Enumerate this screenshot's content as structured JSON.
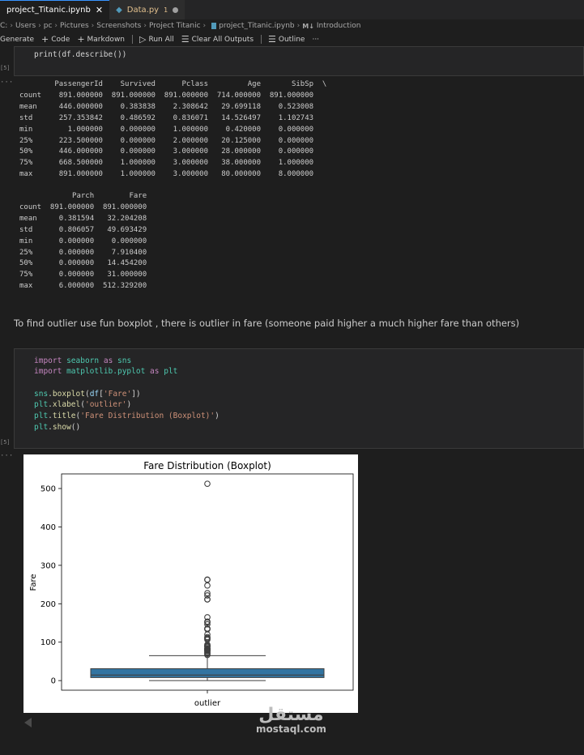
{
  "tabs": [
    {
      "label": "project_Titanic.ipynb",
      "close": "✕",
      "active": true
    },
    {
      "label": "Data.py",
      "badge": "1",
      "active": false
    }
  ],
  "breadcrumb": {
    "items": [
      "C:",
      "Users",
      "pc",
      "Pictures",
      "Screenshots",
      "Project Titanic",
      "project_Titanic.ipynb"
    ],
    "md_prefix": "M↓",
    "last": "Introduction"
  },
  "toolbar": {
    "generate": "Generate",
    "code": "Code",
    "markdown": "Markdown",
    "run_all": "Run All",
    "clear_outputs": "Clear All Outputs",
    "outline": "Outline",
    "more": "···"
  },
  "cell1": {
    "code": "print(df.describe())",
    "exec_count": "[5]",
    "output_marker": "···"
  },
  "describe_table1": "        PassengerId    Survived      Pclass         Age       SibSp  \\\ncount    891.000000  891.000000  891.000000  714.000000  891.000000\nmean     446.000000    0.383838    2.308642   29.699118    0.523008\nstd      257.353842    0.486592    0.836071   14.526497    1.102743\nmin        1.000000    0.000000    1.000000    0.420000    0.000000\n25%      223.500000    0.000000    2.000000   20.125000    0.000000\n50%      446.000000    0.000000    3.000000   28.000000    0.000000\n75%      668.500000    1.000000    3.000000   38.000000    1.000000\nmax      891.000000    1.000000    3.000000   80.000000    8.000000",
  "describe_table2": "            Parch        Fare\ncount  891.000000  891.000000\nmean     0.381594   32.204208\nstd      0.806057   49.693429\nmin      0.000000    0.000000\n25%      0.000000    7.910400\n50%      0.000000   14.454200\n75%      0.000000   31.000000\nmax      6.000000  512.329200",
  "markdown_text": "To find outlier use fun boxplot , there is outlier in fare (someone paid higher a much higher fare than others)",
  "cell2": {
    "exec_count": "[5]",
    "output_marker": "···"
  },
  "chart_data": {
    "type": "boxplot",
    "title": "Fare Distribution (Boxplot)",
    "xlabel": "outlier",
    "ylabel": "Fare",
    "yticks": [
      0,
      100,
      200,
      300,
      400,
      500
    ],
    "ylim": [
      -25,
      538
    ],
    "box": {
      "min": 0,
      "q1": 7.9104,
      "median": 14.4542,
      "q3": 31.0,
      "whisker_high": 65.0,
      "color": "#3274a1"
    },
    "outliers": [
      66.6,
      69.55,
      71.28,
      73.5,
      76.73,
      77.96,
      79.2,
      80,
      81.86,
      82.17,
      83.16,
      83.48,
      86.5,
      89.1,
      90,
      91.08,
      93.5,
      106.43,
      108.9,
      110.88,
      113.28,
      120,
      133.65,
      134.5,
      135.63,
      146.52,
      151.55,
      153.46,
      164.87,
      211.34,
      211.5,
      221.78,
      227.53,
      247.52,
      262.38,
      263,
      512.33
    ]
  },
  "watermark": {
    "arabic": "مستقل",
    "latin": "mostaql.com"
  }
}
